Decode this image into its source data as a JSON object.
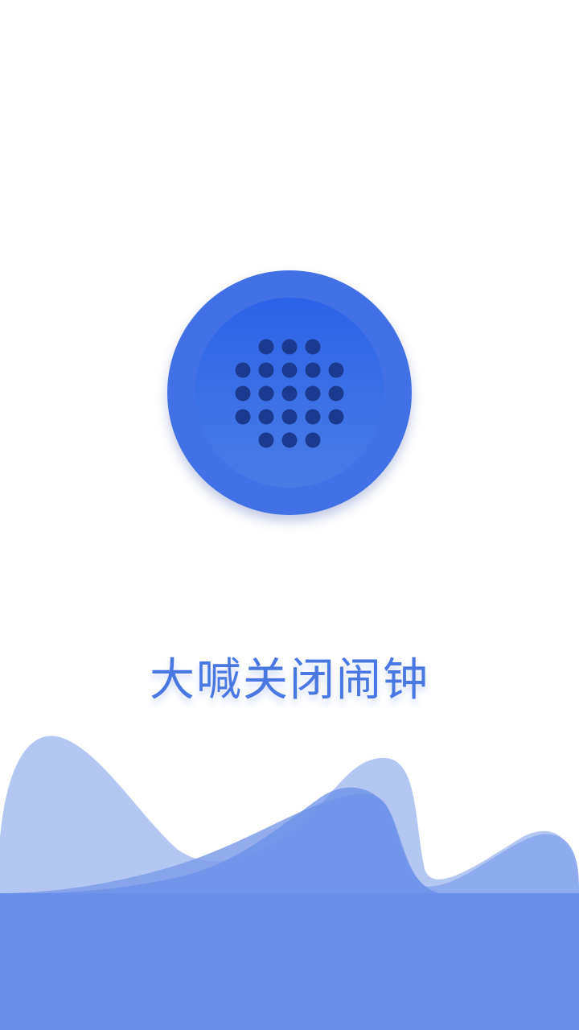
{
  "app": {
    "title": "大喊关闭闹钟"
  },
  "colors": {
    "accent": "#4171e4",
    "accent_inner": "#2c62e6",
    "dots": "#1a3a8f",
    "title": "#4a78e2",
    "wave_front": "#6890e8",
    "wave_back": "#b0c4f2"
  },
  "mic_button": {
    "icon": "microphone-grille-icon"
  }
}
